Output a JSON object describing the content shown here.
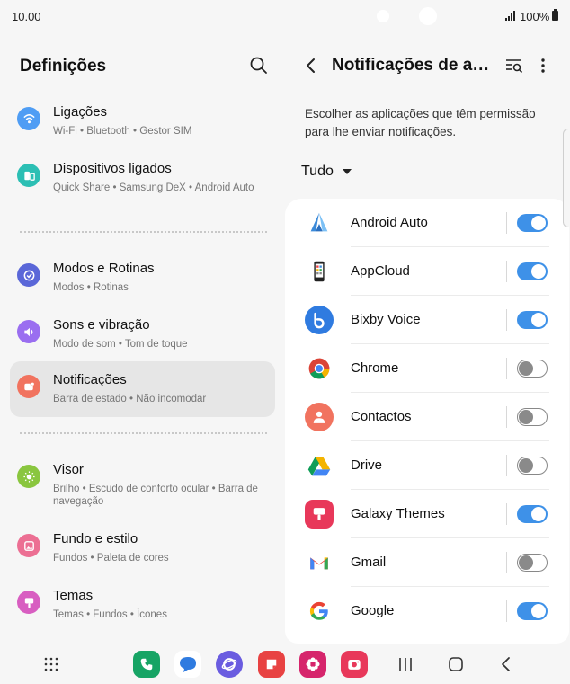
{
  "status_bar": {
    "time": "10.00",
    "battery": "100%"
  },
  "left_panel": {
    "title": "Definições",
    "items": [
      {
        "title": "Ligações",
        "subtitle": "Wi-Fi  •  Bluetooth  •  Gestor SIM",
        "icon": "wifi-icon",
        "color": "#4f9df4"
      },
      {
        "title": "Dispositivos ligados",
        "subtitle": "Quick Share  •  Samsung DeX  •  Android Auto",
        "icon": "devices-icon",
        "color": "#2cbfb4"
      },
      {
        "title": "Modos e Rotinas",
        "subtitle": "Modos  •  Rotinas",
        "icon": "check-circle-icon",
        "color": "#5a67d8"
      },
      {
        "title": "Sons e vibração",
        "subtitle": "Modo de som  •  Tom de toque",
        "icon": "volume-icon",
        "color": "#9a6ef0"
      },
      {
        "title": "Notificações",
        "subtitle": "Barra de estado  •  Não incomodar",
        "icon": "notification-icon",
        "color": "#f1735f"
      },
      {
        "title": "Visor",
        "subtitle": "Brilho  •  Escudo de conforto ocular  •  Barra de navegação",
        "icon": "sun-icon",
        "color": "#8ac63f"
      },
      {
        "title": "Fundo e estilo",
        "subtitle": "Fundos  •  Paleta de cores",
        "icon": "wallpaper-icon",
        "color": "#ec6f93"
      },
      {
        "title": "Temas",
        "subtitle": "Temas  •  Fundos  •  Ícones",
        "icon": "themes-icon",
        "color": "#d85ec1"
      }
    ]
  },
  "right_panel": {
    "title": "Notificações de aplicações",
    "description": "Escolher as aplicações que têm permissão para lhe enviar notificações.",
    "filter": "Tudo",
    "apps": [
      {
        "name": "Android Auto",
        "enabled": true,
        "icon": "android-auto-icon"
      },
      {
        "name": "AppCloud",
        "enabled": true,
        "icon": "appcloud-icon"
      },
      {
        "name": "Bixby Voice",
        "enabled": true,
        "icon": "bixby-icon"
      },
      {
        "name": "Chrome",
        "enabled": false,
        "icon": "chrome-icon"
      },
      {
        "name": "Contactos",
        "enabled": false,
        "icon": "contacts-icon"
      },
      {
        "name": "Drive",
        "enabled": false,
        "icon": "drive-icon"
      },
      {
        "name": "Galaxy Themes",
        "enabled": true,
        "icon": "galaxy-themes-icon"
      },
      {
        "name": "Gmail",
        "enabled": false,
        "icon": "gmail-icon"
      },
      {
        "name": "Google",
        "enabled": true,
        "icon": "google-icon"
      }
    ]
  },
  "taskbar": {
    "apps": [
      "phone-app-icon",
      "messages-app-icon",
      "internet-app-icon",
      "notes-app-icon",
      "gallery-app-icon",
      "camera-app-icon"
    ],
    "accent": "#3e91e8"
  }
}
